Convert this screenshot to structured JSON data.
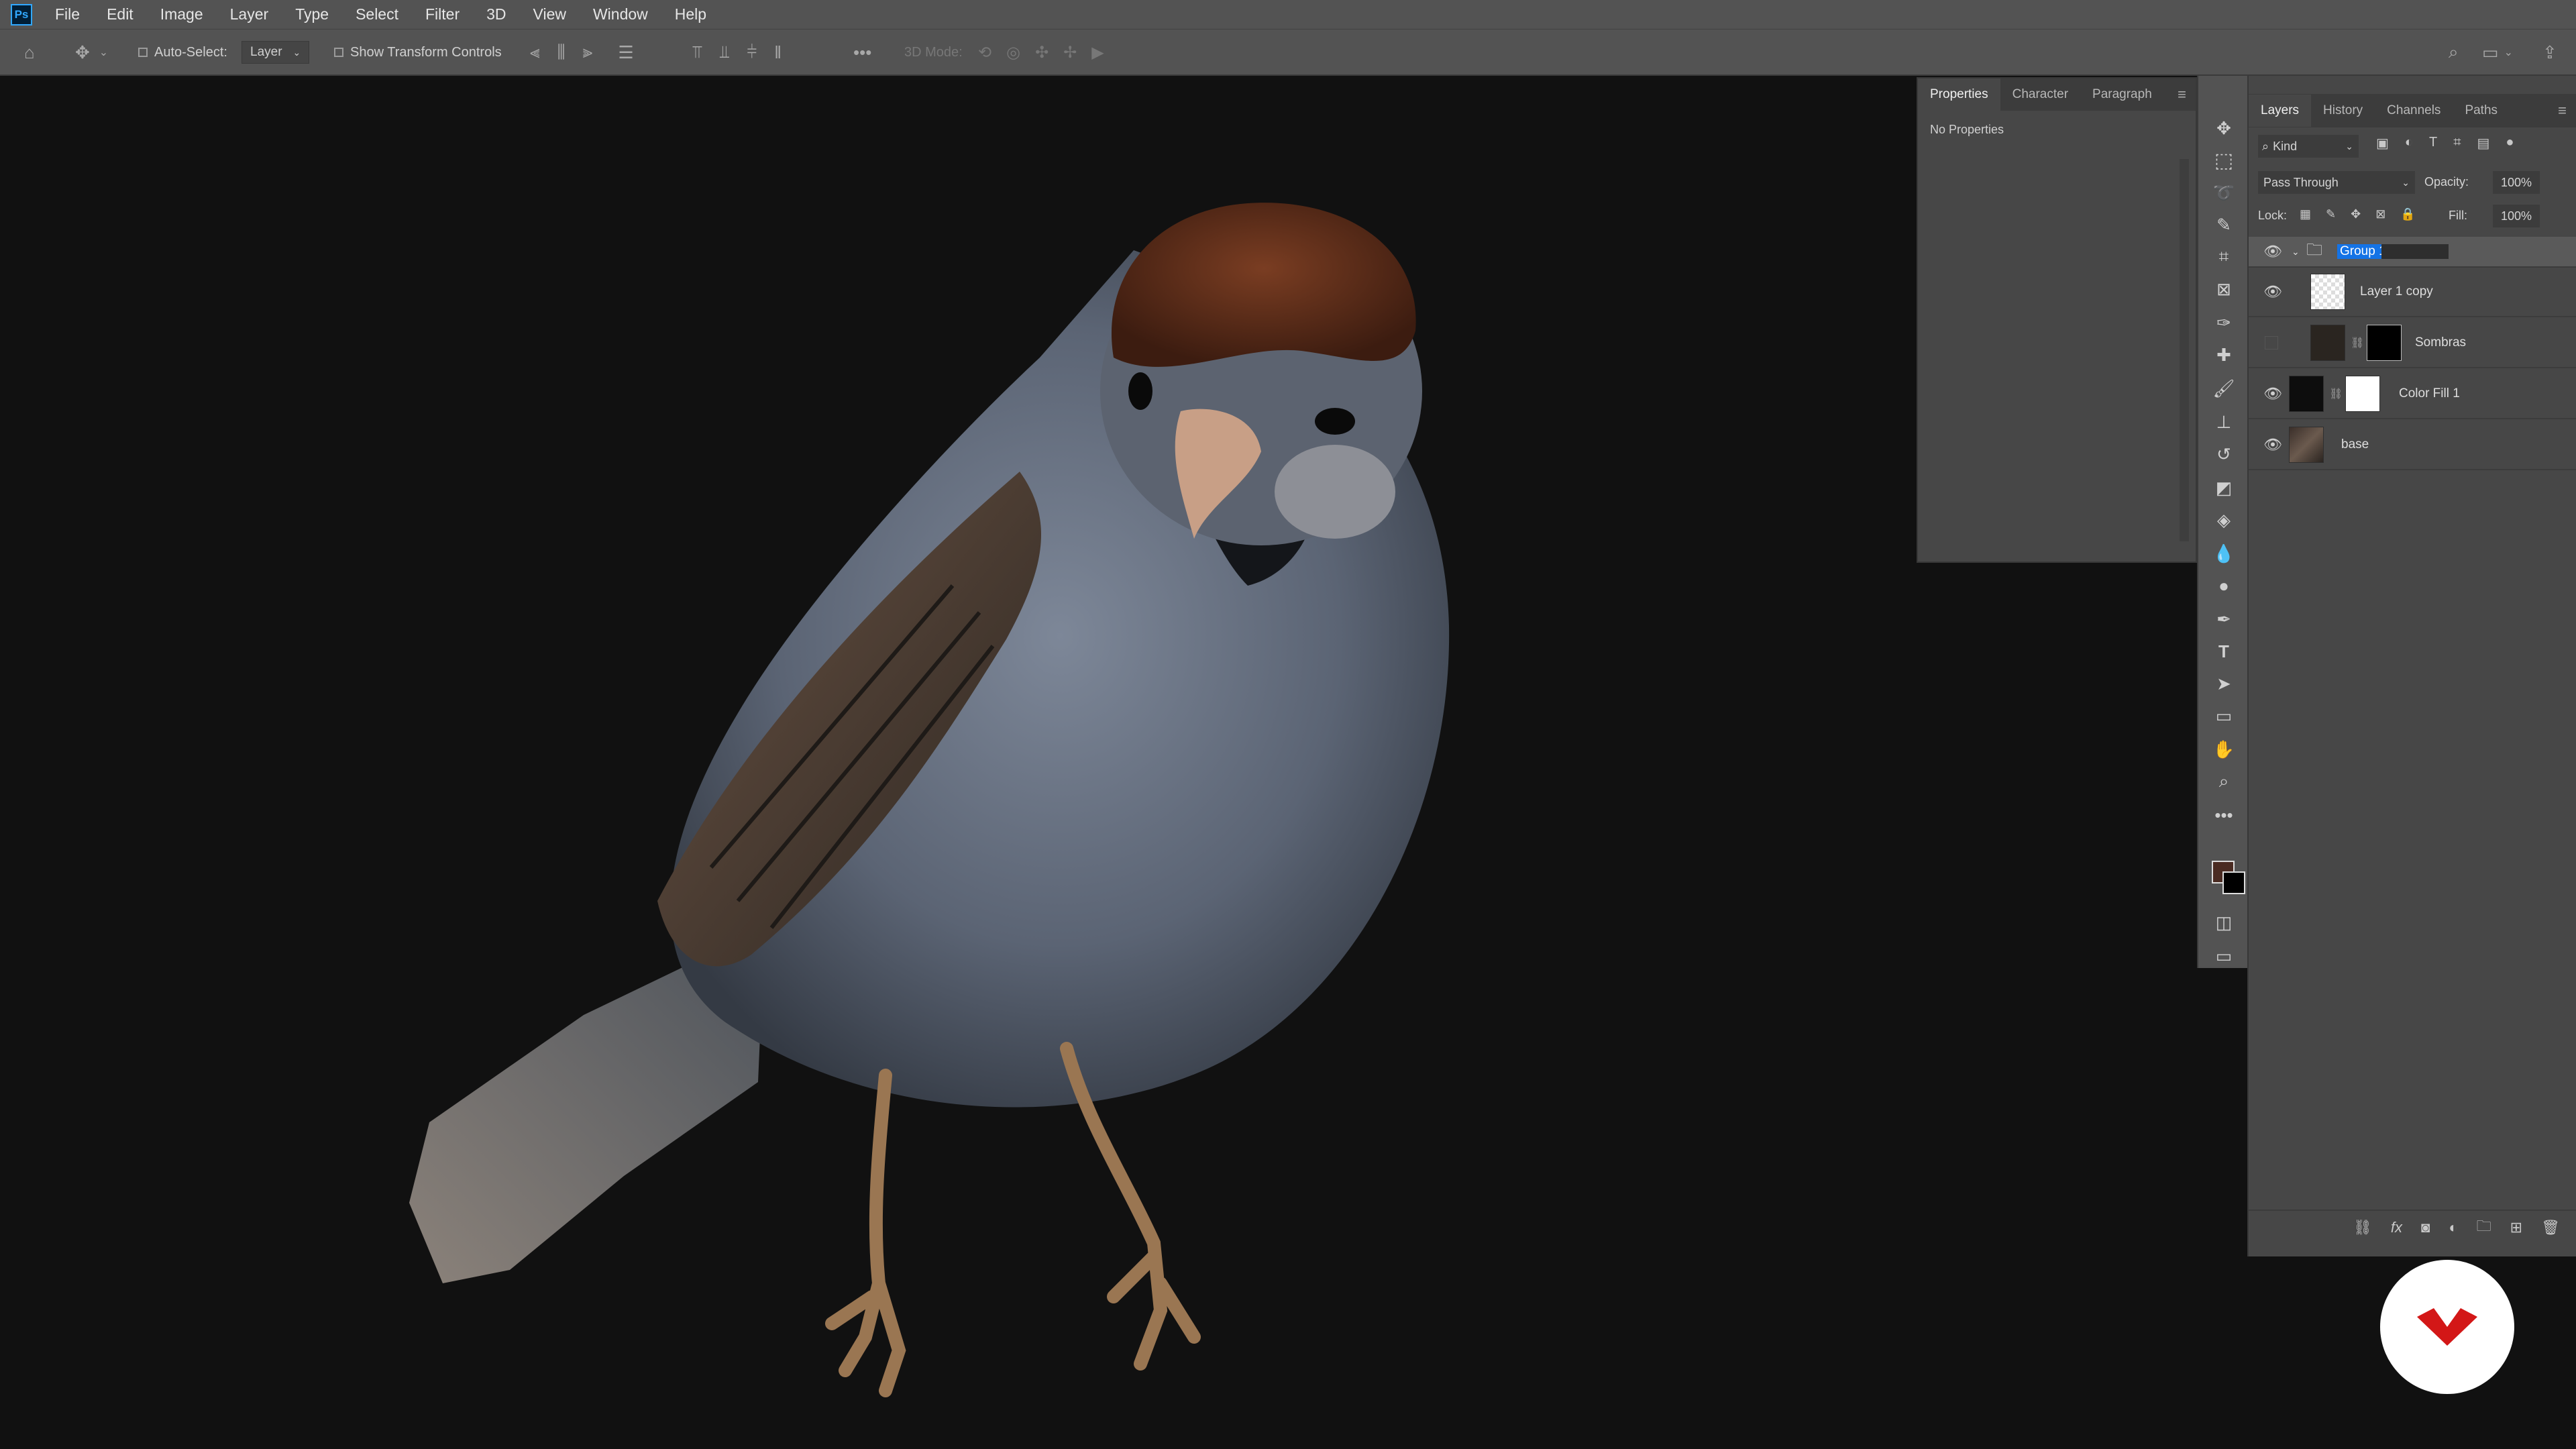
{
  "app": {
    "logo_text": "Ps"
  },
  "menu": [
    "File",
    "Edit",
    "Image",
    "Layer",
    "Type",
    "Select",
    "Filter",
    "3D",
    "View",
    "Window",
    "Help"
  ],
  "options_bar": {
    "auto_select_label": "Auto-Select:",
    "auto_select_value": "Layer",
    "transform_controls_label": "Show Transform Controls",
    "mode_3d_label": "3D Mode:"
  },
  "properties_panel": {
    "tabs": [
      "Properties",
      "Character",
      "Paragraph"
    ],
    "active_tab": "Properties",
    "content_text": "No Properties"
  },
  "layers_panel": {
    "tabs": [
      "Layers",
      "History",
      "Channels",
      "Paths"
    ],
    "active_tab": "Layers",
    "filter_label": "Kind",
    "blend_mode": "Pass Through",
    "opacity_label": "Opacity:",
    "opacity_value": "100%",
    "lock_label": "Lock:",
    "fill_label": "Fill:",
    "fill_value": "100%",
    "layers": [
      {
        "name": "Group 1",
        "type": "group",
        "visible": true,
        "selected": true,
        "editing_name": true
      },
      {
        "name": "Layer 1 copy",
        "type": "smart-object",
        "visible": true
      },
      {
        "name": "Sombras",
        "type": "masked",
        "visible": false
      },
      {
        "name": "Color Fill 1",
        "type": "fill",
        "visible": true
      },
      {
        "name": "base",
        "type": "image",
        "visible": true
      }
    ]
  },
  "colors": {
    "ui_bg": "#535353",
    "panel_bg": "#474747",
    "canvas_bg": "#111111",
    "selection": "#1473e6",
    "brand_red": "#d31717",
    "foreground_swatch": "#4a2b22",
    "background_swatch": "#000000"
  }
}
